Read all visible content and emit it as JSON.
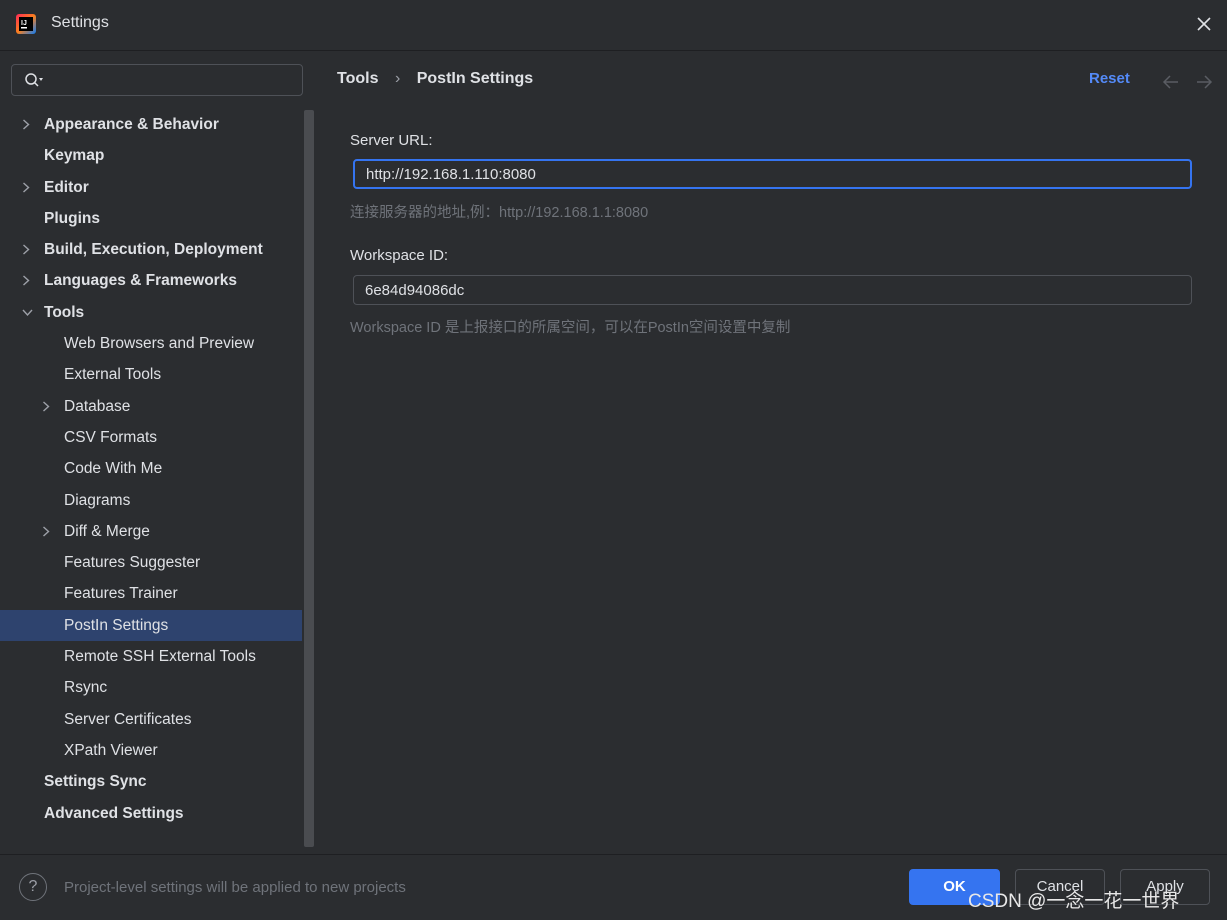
{
  "window": {
    "title": "Settings"
  },
  "search": {
    "value": "",
    "placeholder": ""
  },
  "sidebar": {
    "items": [
      {
        "label": "Appearance & Behavior",
        "level": 0,
        "bold": true,
        "expandable": true,
        "expanded": false
      },
      {
        "label": "Keymap",
        "level": 0,
        "bold": true,
        "expandable": false
      },
      {
        "label": "Editor",
        "level": 0,
        "bold": true,
        "expandable": true,
        "expanded": false
      },
      {
        "label": "Plugins",
        "level": 0,
        "bold": true,
        "expandable": false
      },
      {
        "label": "Build, Execution, Deployment",
        "level": 0,
        "bold": true,
        "expandable": true,
        "expanded": false
      },
      {
        "label": "Languages & Frameworks",
        "level": 0,
        "bold": true,
        "expandable": true,
        "expanded": false
      },
      {
        "label": "Tools",
        "level": 0,
        "bold": true,
        "expandable": true,
        "expanded": true
      },
      {
        "label": "Web Browsers and Preview",
        "level": 1,
        "bold": false,
        "expandable": false
      },
      {
        "label": "External Tools",
        "level": 1,
        "bold": false,
        "expandable": false
      },
      {
        "label": "Database",
        "level": 1,
        "bold": false,
        "expandable": true,
        "expanded": false
      },
      {
        "label": "CSV Formats",
        "level": 1,
        "bold": false,
        "expandable": false
      },
      {
        "label": "Code With Me",
        "level": 1,
        "bold": false,
        "expandable": false
      },
      {
        "label": "Diagrams",
        "level": 1,
        "bold": false,
        "expandable": false
      },
      {
        "label": "Diff & Merge",
        "level": 1,
        "bold": false,
        "expandable": true,
        "expanded": false
      },
      {
        "label": "Features Suggester",
        "level": 1,
        "bold": false,
        "expandable": false
      },
      {
        "label": "Features Trainer",
        "level": 1,
        "bold": false,
        "expandable": false
      },
      {
        "label": "PostIn Settings",
        "level": 1,
        "bold": false,
        "expandable": false,
        "selected": true
      },
      {
        "label": "Remote SSH External Tools",
        "level": 1,
        "bold": false,
        "expandable": false
      },
      {
        "label": "Rsync",
        "level": 1,
        "bold": false,
        "expandable": false
      },
      {
        "label": "Server Certificates",
        "level": 1,
        "bold": false,
        "expandable": false
      },
      {
        "label": "XPath Viewer",
        "level": 1,
        "bold": false,
        "expandable": false
      },
      {
        "label": "Settings Sync",
        "level": 0,
        "bold": true,
        "expandable": false
      },
      {
        "label": "Advanced Settings",
        "level": 0,
        "bold": true,
        "expandable": false
      }
    ]
  },
  "header": {
    "breadcrumb_parent": "Tools",
    "breadcrumb_current": "PostIn Settings",
    "reset_label": "Reset"
  },
  "form": {
    "server_url_label": "Server URL:",
    "server_url_value": "http://192.168.1.110:8080",
    "server_url_hint": "连接服务器的地址,例：http://192.168.1.1:8080",
    "workspace_id_label": "Workspace ID:",
    "workspace_id_value": "6e84d94086dc",
    "workspace_id_hint": "Workspace ID 是上报接口的所属空间，可以在PostIn空间设置中复制"
  },
  "footer": {
    "help_label": "?",
    "note": "Project-level settings will be applied to new projects",
    "ok_label": "OK",
    "cancel_label": "Cancel",
    "apply_label": "Apply",
    "watermark": "CSDN @一念一花一世界"
  },
  "colors": {
    "background": "#2b2d30",
    "accent": "#3574f0",
    "selection": "#2e436e",
    "link": "#548af7"
  }
}
